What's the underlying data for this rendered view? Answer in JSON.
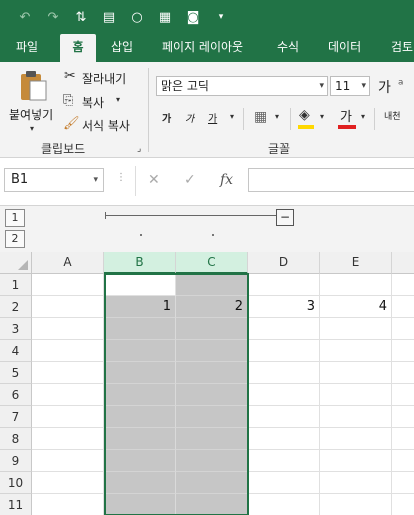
{
  "qat": {
    "items": [
      "undo-icon",
      "redo-icon",
      "sort-icon",
      "form-icon",
      "circle-icon",
      "grid-icon",
      "camera-icon",
      "customize-icon"
    ]
  },
  "tabs": [
    {
      "label": "파일"
    },
    {
      "label": "홈"
    },
    {
      "label": "삽입"
    },
    {
      "label": "페이지 레이아웃"
    },
    {
      "label": "수식"
    },
    {
      "label": "데이터"
    },
    {
      "label": "검토"
    }
  ],
  "ribbon": {
    "paste_label": "붙여넣기",
    "cut_label": "잘라내기",
    "copy_label": "복사",
    "format_painter_label": "서식 복사",
    "clipboard_group": "클립보드",
    "font_name": "맑은 고딕",
    "font_size": "11",
    "grow_font": "가",
    "bold": "가",
    "italic": "가",
    "underline": "가",
    "font_color_glyph": "가",
    "phonetic": "내천",
    "font_group": "글꼴",
    "fill_color": "#ffd800",
    "font_color": "#e02020"
  },
  "formula_bar": {
    "name_box": "B1",
    "cancel": "✕",
    "enter": "✓",
    "fx": "fx",
    "value": ""
  },
  "outline": {
    "levels": [
      "1",
      "2"
    ],
    "collapse": "−"
  },
  "grid": {
    "columns": [
      "A",
      "B",
      "C",
      "D",
      "E"
    ],
    "rows": [
      "1",
      "2",
      "3",
      "4",
      "5",
      "6",
      "7",
      "8",
      "9",
      "10",
      "11"
    ],
    "row2_values": [
      "1",
      "2",
      "3",
      "4"
    ]
  }
}
